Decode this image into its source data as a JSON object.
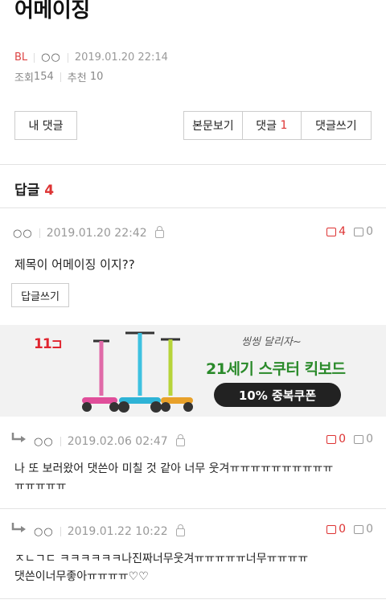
{
  "post": {
    "title": "어메이징",
    "category": "BL",
    "author": "○○",
    "datetime": "2019.01.20 22:14",
    "views_label": "조회",
    "views": "154",
    "recommend_label": "추천",
    "recommend": "10"
  },
  "buttons": {
    "my_comments": "내 댓글",
    "view_body": "본문보기",
    "comments": "댓글",
    "comments_count": "1",
    "write_comment": "댓글쓰기"
  },
  "replies": {
    "label": "답글",
    "count": "4"
  },
  "comments": [
    {
      "author": "○○",
      "datetime": "2019.01.20 22:42",
      "up": "4",
      "down": "0",
      "text": "제목이 어메이징 이지??",
      "reply_button": "답글쓰기"
    },
    {
      "author": "○○",
      "datetime": "2019.02.06 02:47",
      "up": "0",
      "down": "0",
      "text_line1": "나 또 보러왔어 댓쓴아 미칠 것 같아 너무 웃겨ㅠㅠㅠㅠㅠㅠㅠㅠㅠㅠ",
      "text_line2": "ㅠㅠㅠㅠㅠ"
    },
    {
      "author": "○○",
      "datetime": "2019.01.22 10:22",
      "up": "0",
      "down": "0",
      "text_line1": "ㅈㄴㄱㄷ ㅋㅋㅋㅋㅋㅋ나진짜너무웃겨ㅠㅠㅠㅠㅠ너무ㅠㅠㅠㅠ",
      "text_line2": "댓쓴이너무좋아ㅠㅠㅠㅠ♡♡"
    }
  ],
  "ad": {
    "logo": "11⊐",
    "tagline": "씽씽 달리자~",
    "headline": "21세기 스쿠터 킥보드",
    "coupon": "10% 중복쿠폰"
  }
}
